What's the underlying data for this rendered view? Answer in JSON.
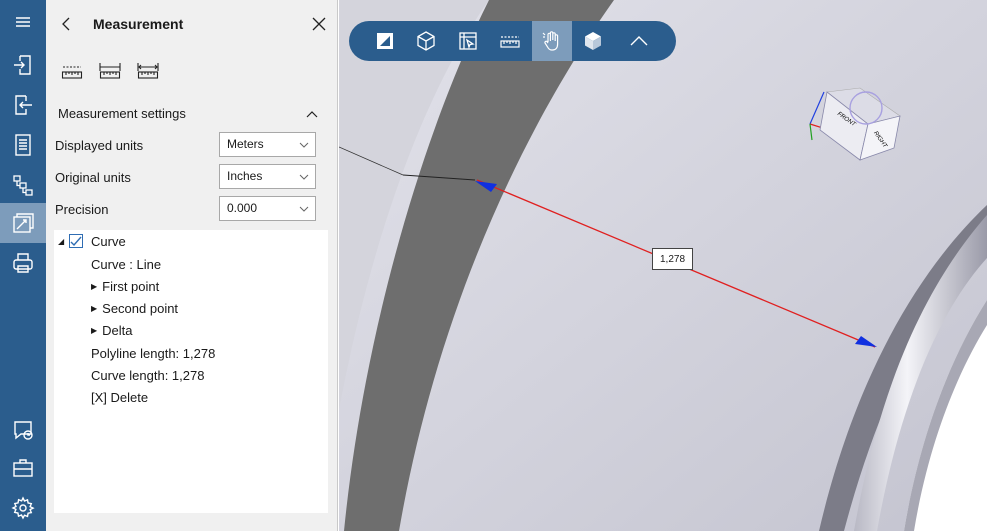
{
  "rail": {
    "items": [
      {
        "icon": "menu-icon"
      },
      {
        "icon": "import-icon"
      },
      {
        "icon": "export-icon"
      },
      {
        "icon": "document-icon"
      },
      {
        "icon": "hierarchy-icon"
      },
      {
        "icon": "measurement-icon",
        "active": true
      },
      {
        "icon": "print-icon"
      },
      {
        "icon": "feedback-icon"
      },
      {
        "icon": "briefcase-icon"
      },
      {
        "icon": "settings-icon"
      }
    ]
  },
  "panel": {
    "title": "Measurement",
    "tools": [
      "point-to-point-icon",
      "distance-icon",
      "width-icon"
    ],
    "settings": {
      "title": "Measurement settings",
      "displayed_units": {
        "label": "Displayed units",
        "value": "Meters"
      },
      "original_units": {
        "label": "Original units",
        "value": "Inches"
      },
      "precision": {
        "label": "Precision",
        "value": "0.000"
      }
    },
    "tree": {
      "curve": "Curve",
      "curve_type": "Curve : Line",
      "first_point": "First point",
      "second_point": "Second point",
      "delta": "Delta",
      "polyline_length": "Polyline length: 1,278",
      "curve_length": "Curve length: 1,278",
      "delete": "[X] Delete"
    }
  },
  "toolbar": {
    "items": [
      {
        "icon": "section-icon"
      },
      {
        "icon": "view-cube-icon"
      },
      {
        "icon": "select-area-icon"
      },
      {
        "icon": "measure-icon"
      },
      {
        "icon": "pan-hand-icon",
        "active": true
      },
      {
        "icon": "shaded-cube-icon"
      },
      {
        "icon": "collapse-icon"
      }
    ]
  },
  "viewport": {
    "dimension_label": "1,278",
    "nav_cube": {
      "front": "FRONT",
      "right": "RIGHT"
    }
  },
  "colors": {
    "rail": "#2b5d8d",
    "active": "#7d9cbb",
    "measure_line": "#e02020",
    "arrow": "#1030e0"
  }
}
